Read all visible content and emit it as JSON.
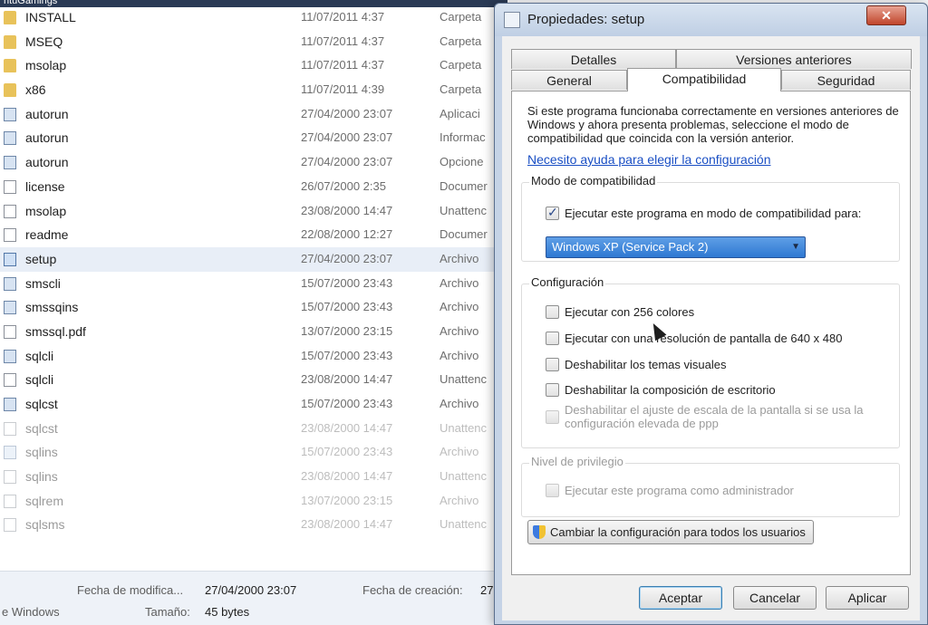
{
  "explorer": {
    "title": "ntuGamings",
    "files": [
      {
        "name": "INSTALL",
        "date": "11/07/2011 4:37",
        "type": "Carpeta",
        "icon": "folder-icon"
      },
      {
        "name": "MSEQ",
        "date": "11/07/2011 4:37",
        "type": "Carpeta",
        "icon": "folder-icon"
      },
      {
        "name": "msolap",
        "date": "11/07/2011 4:37",
        "type": "Carpeta",
        "icon": "folder-icon"
      },
      {
        "name": "x86",
        "date": "11/07/2011 4:39",
        "type": "Carpeta",
        "icon": "folder-icon"
      },
      {
        "name": "autorun",
        "date": "27/04/2000 23:07",
        "type": "Aplicaci",
        "icon": "app-icon"
      },
      {
        "name": "autorun",
        "date": "27/04/2000 23:07",
        "type": "Informac",
        "icon": "app-icon"
      },
      {
        "name": "autorun",
        "date": "27/04/2000 23:07",
        "type": "Opcione",
        "icon": "app-icon"
      },
      {
        "name": "license",
        "date": "26/07/2000 2:35",
        "type": "Documer",
        "icon": "document-icon"
      },
      {
        "name": "msolap",
        "date": "23/08/2000 14:47",
        "type": "Unattenc",
        "icon": "document-icon"
      },
      {
        "name": "readme",
        "date": "22/08/2000 12:27",
        "type": "Documer",
        "icon": "document-icon"
      },
      {
        "name": "setup",
        "date": "27/04/2000 23:07",
        "type": "Archivo",
        "icon": "setup-icon"
      },
      {
        "name": "smscli",
        "date": "15/07/2000 23:43",
        "type": "Archivo",
        "icon": "app-icon"
      },
      {
        "name": "smssqins",
        "date": "15/07/2000 23:43",
        "type": "Archivo",
        "icon": "app-icon"
      },
      {
        "name": "smssql.pdf",
        "date": "13/07/2000 23:15",
        "type": "Archivo",
        "icon": "document-icon"
      },
      {
        "name": "sqlcli",
        "date": "15/07/2000 23:43",
        "type": "Archivo",
        "icon": "app-icon"
      },
      {
        "name": "sqlcli",
        "date": "23/08/2000 14:47",
        "type": "Unattenc",
        "icon": "document-icon"
      },
      {
        "name": "sqlcst",
        "date": "15/07/2000 23:43",
        "type": "Archivo",
        "icon": "app-icon"
      },
      {
        "name": "sqlcst",
        "date": "23/08/2000 14:47",
        "type": "Unattenc",
        "icon": "document-icon"
      },
      {
        "name": "sqlins",
        "date": "15/07/2000 23:43",
        "type": "Archivo",
        "icon": "app-icon"
      },
      {
        "name": "sqlins",
        "date": "23/08/2000 14:47",
        "type": "Unattenc",
        "icon": "document-icon"
      },
      {
        "name": "sqlrem",
        "date": "13/07/2000 23:15",
        "type": "Archivo",
        "icon": "document-icon"
      },
      {
        "name": "sqlsms",
        "date": "23/08/2000 14:47",
        "type": "Unattenc",
        "icon": "document-icon"
      }
    ],
    "selected_file": "setup",
    "details": {
      "modified_label": "Fecha de modifica...",
      "modified_value": "27/04/2000 23:07",
      "created_label": "Fecha de creación:",
      "created_value": "27",
      "size_label": "Tamaño:",
      "size_value": "45 bytes",
      "type_partial": "e Windows"
    }
  },
  "dialog": {
    "title": "Propiedades: setup",
    "close_label": "✕",
    "tabs_back": [
      {
        "label": "Detalles"
      },
      {
        "label": "Versiones anteriores"
      }
    ],
    "tabs_front": [
      {
        "label": "General"
      },
      {
        "label": "Compatibilidad"
      },
      {
        "label": "Seguridad"
      }
    ],
    "active_tab": "Compatibilidad",
    "intro_text": "Si este programa funcionaba correctamente en versiones anteriores de Windows y ahora presenta problemas, seleccione el modo de compatibilidad que coincida con la versión anterior.",
    "help_link": "Necesito ayuda para elegir la configuración",
    "compat_mode": {
      "group_title": "Modo de compatibilidad",
      "run_in_compat_label": "Ejecutar este programa en modo de compatibilidad para:",
      "run_in_compat_checked": true,
      "selected_os": "Windows XP (Service Pack 2)"
    },
    "settings": {
      "group_title": "Configuración",
      "options": [
        {
          "label": "Ejecutar con 256 colores",
          "checked": false,
          "disabled": false
        },
        {
          "label": "Ejecutar con una resolución de pantalla de 640 x 480",
          "checked": false,
          "disabled": false
        },
        {
          "label": "Deshabilitar los temas visuales",
          "checked": false,
          "disabled": false
        },
        {
          "label": "Deshabilitar la composición de escritorio",
          "checked": false,
          "disabled": false
        },
        {
          "label": "Deshabilitar el ajuste de escala de la pantalla si se usa la configuración elevada de ppp",
          "checked": false,
          "disabled": true
        }
      ]
    },
    "privilege": {
      "group_title": "Nivel de privilegio",
      "run_as_admin_label": "Ejecutar este programa como administrador",
      "run_as_admin_checked": false,
      "disabled": true
    },
    "change_all_button": "Cambiar la configuración para todos los usuarios",
    "buttons": {
      "ok": "Aceptar",
      "cancel": "Cancelar",
      "apply": "Aplicar"
    }
  },
  "colors": {
    "accent": "#2e78d2",
    "link": "#1a4fc4",
    "close_button": "#c0452b",
    "folder": "#e8c25a"
  }
}
